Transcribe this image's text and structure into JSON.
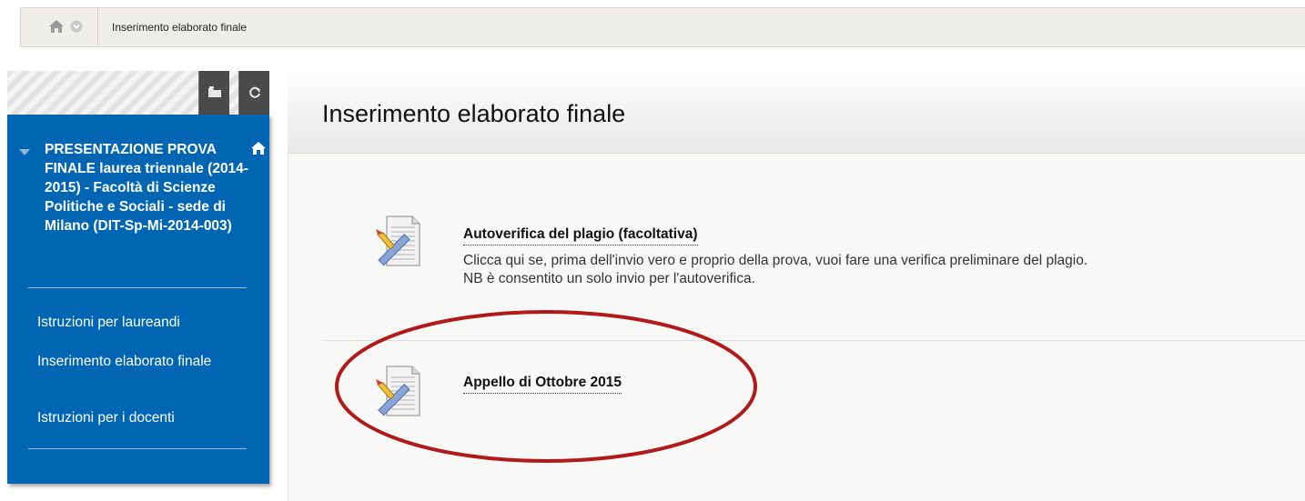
{
  "breadcrumb": {
    "current": "Inserimento elaborato finale",
    "home_icon": "home-icon",
    "menu_icon": "circle-chevron-icon"
  },
  "course_menu": {
    "header_buttons": [
      "folder-icon",
      "refresh-icon"
    ],
    "course_title": "PRESENTAZIONE PROVA FINALE laurea triennale (2014-2015) - Facoltà di Scienze Politiche e Sociali - sede di Milano (DIT-Sp-Mi-2014-003)",
    "items": [
      {
        "label": "Istruzioni per laureandi"
      },
      {
        "label": "Inserimento elaborato finale"
      },
      {
        "label": "Istruzioni per i docenti"
      }
    ],
    "panel_color": "#0066b3"
  },
  "main": {
    "page_title": "Inserimento elaborato finale",
    "content_items": [
      {
        "icon": "assignment-icon",
        "title": "Autoverifica del plagio (facoltativa)",
        "description_line1": "Clicca qui se, prima dell'invio vero e proprio della prova, vuoi fare una verifica preliminare del plagio.",
        "description_line2": "NB è consentito un solo invio per l'autoverifica."
      },
      {
        "icon": "assignment-icon",
        "title": "Appello di Ottobre 2015"
      }
    ]
  },
  "annotation": {
    "color": "#b01a1a"
  }
}
